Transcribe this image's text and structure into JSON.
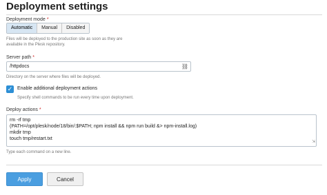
{
  "page": {
    "title": "Deployment settings"
  },
  "deployment_mode": {
    "label": "Deployment mode",
    "required": "*",
    "options": [
      "Automatic",
      "Manual",
      "Disabled"
    ],
    "selected": "Automatic",
    "help_line1": "Files will be deployed to the production site as soon as they are",
    "help_line2": "available in the Plesk repository."
  },
  "server_path": {
    "label": "Server path",
    "required": "*",
    "value": "/httpdocs",
    "icon": "folder-browse-icon",
    "help": "Directory on the server where files will be deployed."
  },
  "additional_actions": {
    "checked": true,
    "label": "Enable additional deployment actions",
    "help": "Specify shell commands to be run every time upon deployment."
  },
  "deploy_actions": {
    "label": "Deploy actions",
    "required": "*",
    "lines": [
      "rm -rf tmp",
      "(PATH=/opt/plesk/node/18/bin/:$PATH;  npm install && npm run build &> npm-install.log)",
      "mkdir tmp",
      "touch tmp/restart.txt"
    ],
    "help": "Type each command on a new line."
  },
  "buttons": {
    "apply": "Apply",
    "cancel": "Cancel"
  },
  "colors": {
    "accent": "#2d8fd5",
    "apply_button": "#4a9ee0",
    "required": "#d02020"
  }
}
